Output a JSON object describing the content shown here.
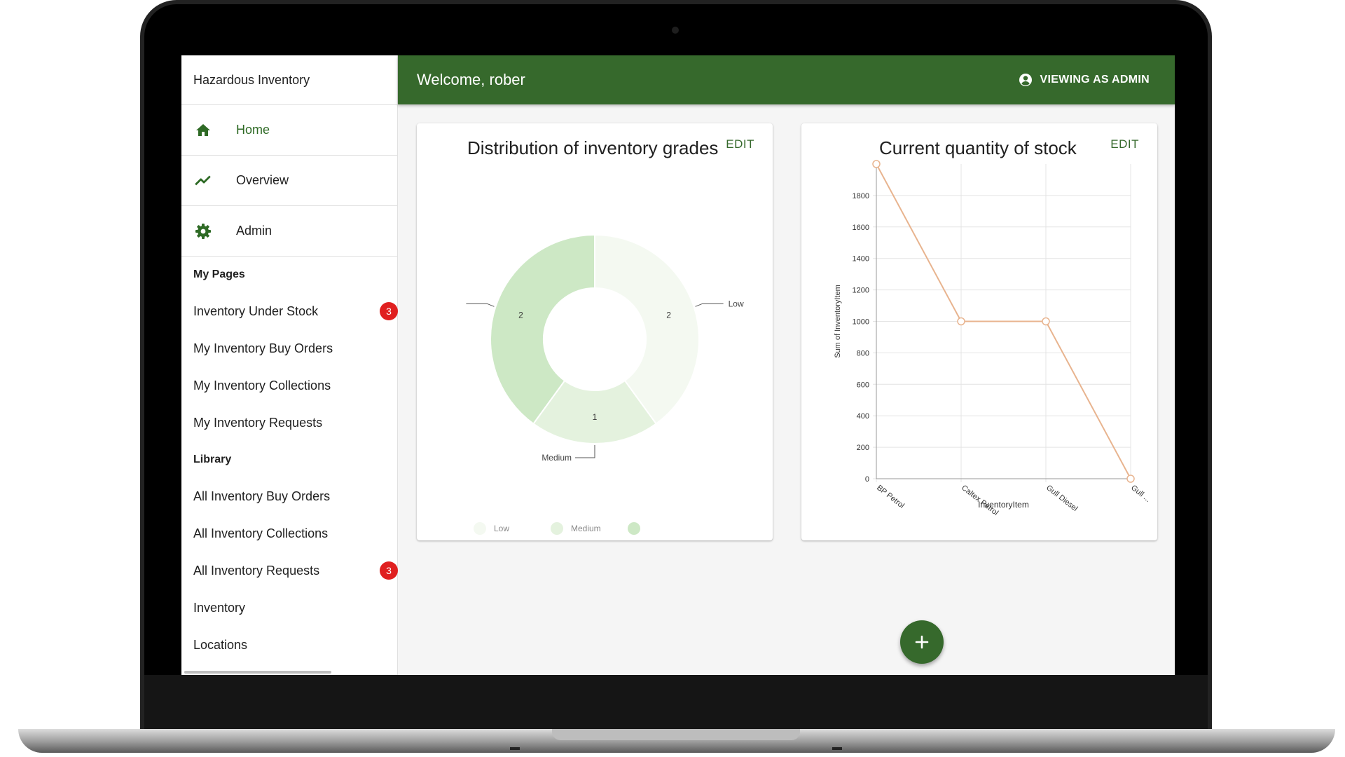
{
  "app": {
    "title": "Hazardous Inventory"
  },
  "nav": [
    {
      "label": "Home",
      "icon": "home-icon",
      "active": true
    },
    {
      "label": "Overview",
      "icon": "trending-up-icon",
      "active": false
    },
    {
      "label": "Admin",
      "icon": "gear-icon",
      "active": false
    }
  ],
  "my_pages": {
    "heading": "My Pages",
    "items": [
      {
        "label": "Inventory Under Stock",
        "badge": "3"
      },
      {
        "label": "My Inventory Buy Orders"
      },
      {
        "label": "My Inventory Collections"
      },
      {
        "label": "My Inventory Requests"
      }
    ]
  },
  "library": {
    "heading": "Library",
    "items": [
      {
        "label": "All Inventory Buy Orders"
      },
      {
        "label": "All Inventory Collections"
      },
      {
        "label": "All Inventory Requests",
        "badge": "3"
      },
      {
        "label": "Inventory"
      },
      {
        "label": "Locations"
      }
    ]
  },
  "header": {
    "welcome": "Welcome, rober",
    "viewing": "VIEWING AS ADMIN",
    "viewing_icon": "account-circle-icon"
  },
  "cards": {
    "donut": {
      "title": "Distribution of inventory grades",
      "edit": "EDIT"
    },
    "line": {
      "title": "Current quantity of stock",
      "edit": "EDIT"
    }
  },
  "fab": {
    "icon": "plus-icon"
  },
  "colors": {
    "primary": "#36692c",
    "badge": "#e02020",
    "line": "#e8b48f"
  },
  "chart_data": [
    {
      "type": "pie",
      "title": "Distribution of inventory grades",
      "slices": [
        {
          "label": "Low",
          "value": 2,
          "color": "#f4f9f1"
        },
        {
          "label": "Medium",
          "value": 1,
          "color": "#e4f2de"
        },
        {
          "label": "",
          "value": 2,
          "color": "#cde8c5"
        }
      ],
      "legend": [
        "Low",
        "Medium",
        ""
      ],
      "legend_position": "bottom"
    },
    {
      "type": "line",
      "title": "Current quantity of stock",
      "xlabel": "InventoryItem",
      "ylabel": "Sum of InventoryItem",
      "categories": [
        "BP Petrol",
        "Caltex Petrol",
        "Gull Diesel",
        "Gull ..."
      ],
      "values": [
        2000,
        1000,
        1000,
        0
      ],
      "yticks": [
        0,
        200,
        400,
        600,
        800,
        1000,
        1200,
        1400,
        1600,
        1800
      ],
      "ylim": [
        0,
        2000
      ],
      "grid": true
    }
  ]
}
